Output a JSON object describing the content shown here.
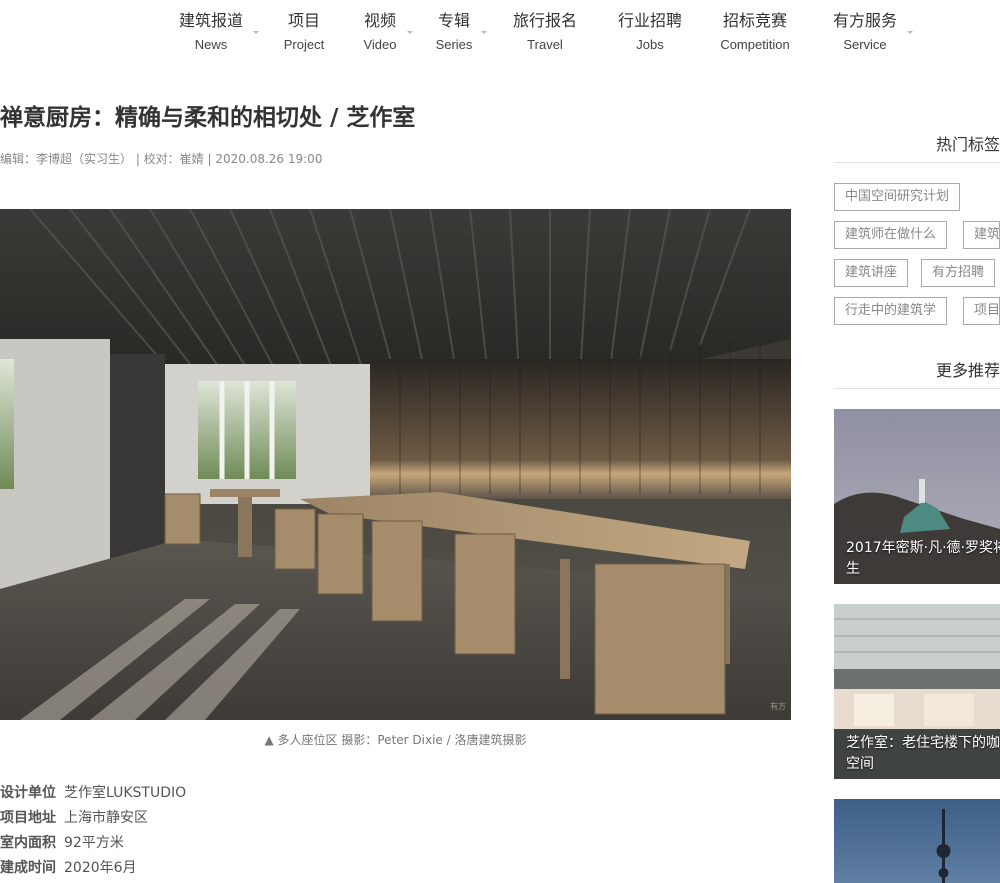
{
  "nav": [
    {
      "cn": "建筑报道",
      "en": "News"
    },
    {
      "cn": "项目",
      "en": "Project"
    },
    {
      "cn": "视频",
      "en": "Video"
    },
    {
      "cn": "专辑",
      "en": "Series"
    },
    {
      "cn": "旅行报名",
      "en": "Travel"
    },
    {
      "cn": "行业招聘",
      "en": "Jobs"
    },
    {
      "cn": "招标竞赛",
      "en": "Competition"
    },
    {
      "cn": "有方服务",
      "en": "Service"
    }
  ],
  "article": {
    "title": "禅意厨房：精确与柔和的相切处 / 芝作室",
    "meta": "编辑：李博超（实习生） | 校对：崔婧 | 2020.08.26 19:00",
    "caption": "▲ 多人座位区  摄影：Peter Dixie / 洛唐建筑摄影",
    "watermark": "有方",
    "info": [
      {
        "k": "设计单位",
        "v": "芝作室LUKSTUDIO"
      },
      {
        "k": "项目地址",
        "v": "上海市静安区"
      },
      {
        "k": "室内面积",
        "v": "92平方米"
      },
      {
        "k": "建成时间",
        "v": "2020年6月"
      }
    ]
  },
  "sidebar": {
    "hot_tags_title": "热门标签",
    "tags": [
      "中国空间研究计划",
      "建筑师在做什么",
      "建筑",
      "建筑讲座",
      "有方招聘",
      "行走中的建筑学",
      "项目"
    ],
    "more_title": "更多推荐",
    "cards": [
      {
        "line1": "2017年密斯·凡·德·罗奖将",
        "line2": "生"
      },
      {
        "line1": "芝作室：老住宅楼下的咖",
        "line2": "空间"
      },
      {
        "line1": "",
        "line2": ""
      }
    ]
  },
  "colors": {
    "text": "#333333",
    "meta": "#888888",
    "tag_border": "#aaaaaa",
    "divider": "#e3e3e3"
  }
}
